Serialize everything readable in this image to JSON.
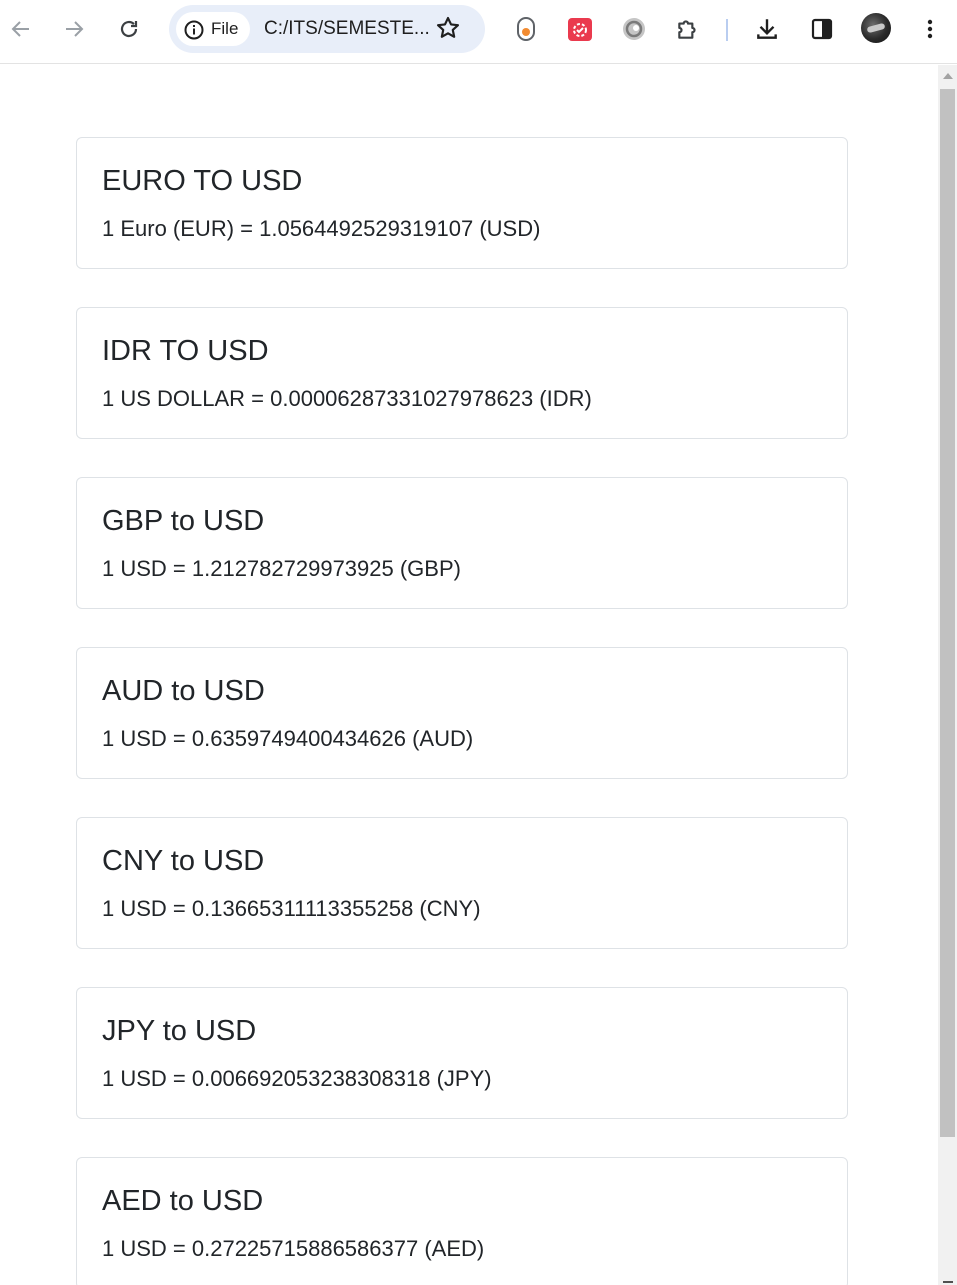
{
  "browser": {
    "address_chip_label": "File",
    "url": "C:/ITS/SEMESTE...",
    "icons": {
      "back": "back-arrow-icon",
      "forward": "forward-arrow-icon",
      "reload": "reload-icon",
      "info": "info-icon",
      "bookmark": "star-icon",
      "extensions": [
        "extension-orange-icon",
        "extension-red-calendar-icon",
        "extension-gray-circle-icon",
        "puzzle-icon"
      ],
      "download": "download-icon",
      "side_panel": "side-panel-icon",
      "menu": "kebab-menu-icon"
    }
  },
  "cards": [
    {
      "title": "EURO TO USD",
      "text": "1 Euro (EUR) = 1.0564492529319107 (USD)"
    },
    {
      "title": "IDR TO USD",
      "text": "1 US DOLLAR = 0.00006287331027978623 (IDR)"
    },
    {
      "title": "GBP to USD",
      "text": "1 USD = 1.212782729973925 (GBP)"
    },
    {
      "title": "AUD to USD",
      "text": "1 USD = 0.6359749400434626 (AUD)"
    },
    {
      "title": "CNY to USD",
      "text": "1 USD = 0.13665311113355258 (CNY)"
    },
    {
      "title": "JPY to USD",
      "text": "1 USD = 0.006692053238308318 (JPY)"
    },
    {
      "title": "AED to USD",
      "text": "1 USD = 0.27225715886586377 (AED)"
    }
  ]
}
